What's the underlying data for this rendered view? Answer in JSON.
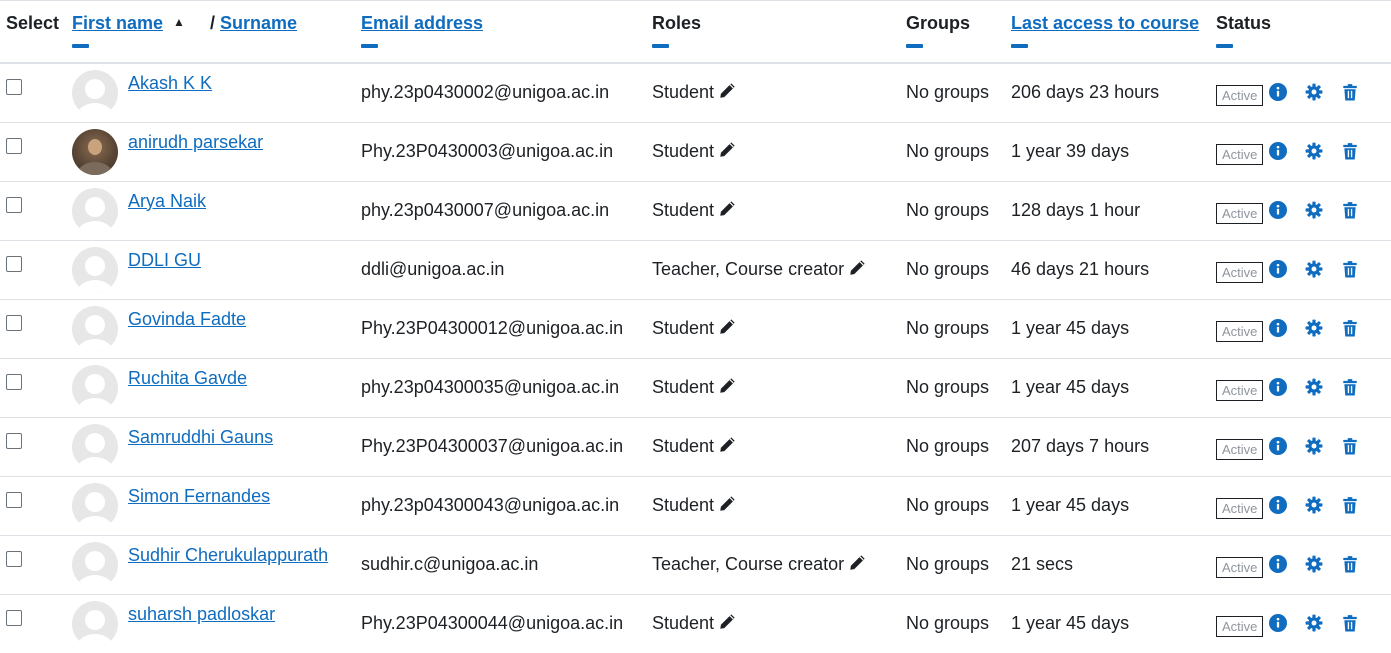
{
  "header": {
    "select": "Select",
    "first_name": "First name",
    "separator": "/",
    "surname": "Surname",
    "email": "Email address",
    "roles": "Roles",
    "groups": "Groups",
    "last_access": "Last access to course",
    "status": "Status"
  },
  "icons": {
    "sort": "caret-up-icon",
    "edit": "pencil-icon",
    "info": "info-icon",
    "settings": "gear-icon",
    "delete": "trash-icon"
  },
  "colors": {
    "link": "#0f6cbf",
    "text": "#1d2125",
    "badge_text": "#8f959e"
  },
  "rows": [
    {
      "name": "Akash K K",
      "email": "phy.23p0430002@unigoa.ac.in",
      "roles": "Student",
      "groups": "No groups",
      "last_access": "206 days 23 hours",
      "status": "Active",
      "avatar": "default"
    },
    {
      "name": "anirudh parsekar",
      "email": "Phy.23P0430003@unigoa.ac.in",
      "roles": "Student",
      "groups": "No groups",
      "last_access": "1 year 39 days",
      "status": "Active",
      "avatar": "photo"
    },
    {
      "name": "Arya Naik",
      "email": "phy.23p0430007@unigoa.ac.in",
      "roles": "Student",
      "groups": "No groups",
      "last_access": "128 days 1 hour",
      "status": "Active",
      "avatar": "default"
    },
    {
      "name": "DDLI GU",
      "email": "ddli@unigoa.ac.in",
      "roles": "Teacher, Course creator",
      "groups": "No groups",
      "last_access": "46 days 21 hours",
      "status": "Active",
      "avatar": "default"
    },
    {
      "name": "Govinda Fadte",
      "email": "Phy.23P04300012@unigoa.ac.in",
      "roles": "Student",
      "groups": "No groups",
      "last_access": "1 year 45 days",
      "status": "Active",
      "avatar": "default"
    },
    {
      "name": "Ruchita Gavde",
      "email": "phy.23p04300035@unigoa.ac.in",
      "roles": "Student",
      "groups": "No groups",
      "last_access": "1 year 45 days",
      "status": "Active",
      "avatar": "default"
    },
    {
      "name": "Samruddhi Gauns",
      "email": "Phy.23P04300037@unigoa.ac.in",
      "roles": "Student",
      "groups": "No groups",
      "last_access": "207 days 7 hours",
      "status": "Active",
      "avatar": "default"
    },
    {
      "name": "Simon Fernandes",
      "email": "phy.23p04300043@unigoa.ac.in",
      "roles": "Student",
      "groups": "No groups",
      "last_access": "1 year 45 days",
      "status": "Active",
      "avatar": "default"
    },
    {
      "name": "Sudhir Cherukulappurath",
      "email": "sudhir.c@unigoa.ac.in",
      "roles": "Teacher, Course creator",
      "groups": "No groups",
      "last_access": "21 secs",
      "status": "Active",
      "avatar": "default"
    },
    {
      "name": "suharsh padloskar",
      "email": "Phy.23P04300044@unigoa.ac.in",
      "roles": "Student",
      "groups": "No groups",
      "last_access": "1 year 45 days",
      "status": "Active",
      "avatar": "default"
    }
  ]
}
